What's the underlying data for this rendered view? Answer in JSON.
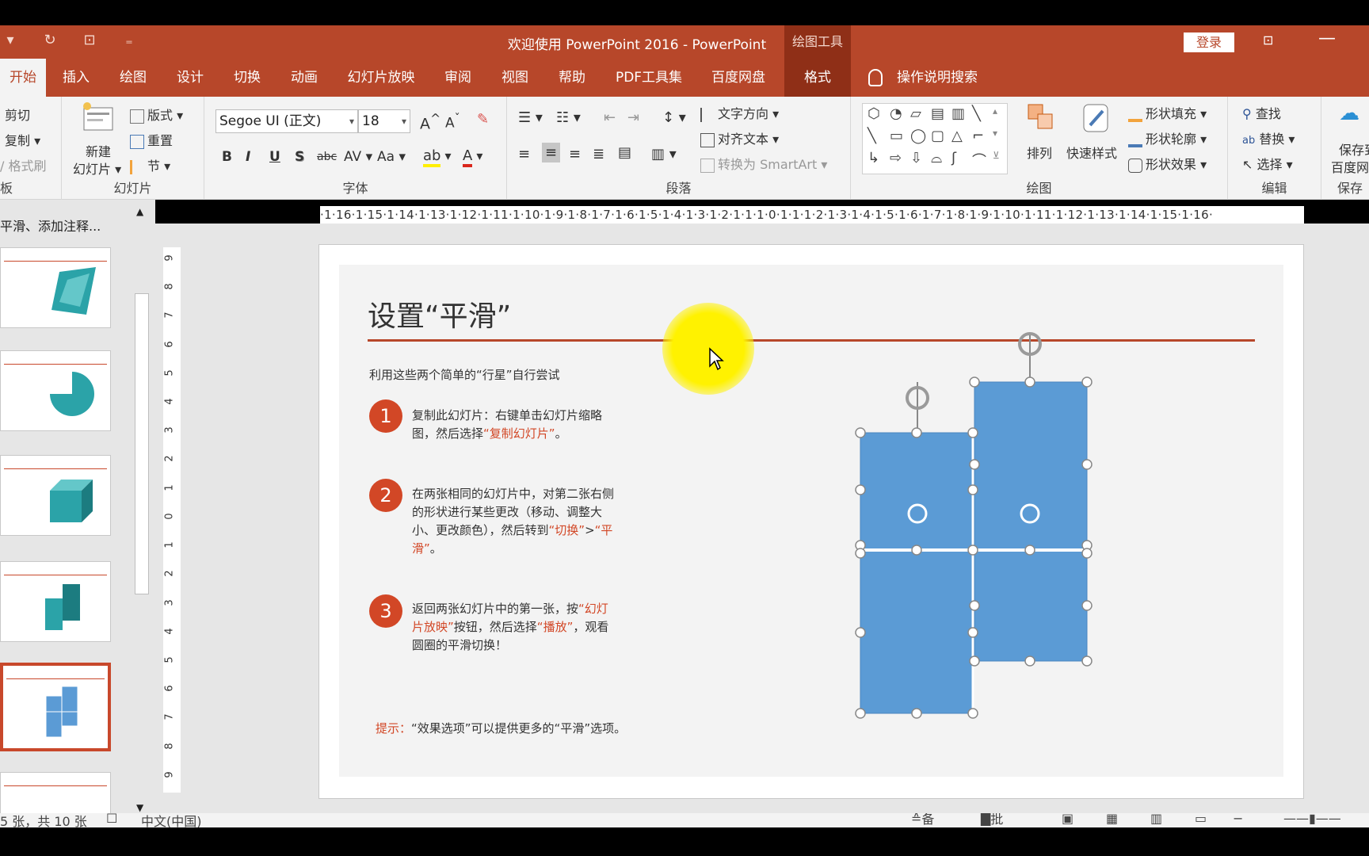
{
  "titlebar": {
    "title": "欢迎使用 PowerPoint 2016  -  PowerPoint",
    "contextual_tab_group": "绘图工具",
    "login": "登录",
    "qat": [
      "▾",
      "↻",
      "⊡",
      "₌"
    ]
  },
  "tabs": [
    "开始",
    "插入",
    "绘图",
    "设计",
    "切换",
    "动画",
    "幻灯片放映",
    "审阅",
    "视图",
    "帮助",
    "PDF工具集",
    "百度网盘",
    "格式"
  ],
  "active_tab": "开始",
  "tellme": "操作说明搜索",
  "ribbon": {
    "clipboard": {
      "cut": "剪切",
      "copy": "复制",
      "format_painter": "格式刷",
      "label": "板"
    },
    "slides": {
      "new_slide_1": "新建",
      "new_slide_2": "幻灯片",
      "layout": "版式",
      "reset": "重置",
      "section": "节",
      "label": "幻灯片"
    },
    "font": {
      "font_name": "Segoe UI (正文)",
      "font_size": "18",
      "label": "字体",
      "buttons": [
        "B",
        "I",
        "U",
        "S",
        "abc",
        "AV",
        "Aa"
      ]
    },
    "paragraph": {
      "text_direction": "文字方向",
      "align_text": "对齐文本",
      "smartart": "转换为 SmartArt",
      "label": "段落"
    },
    "drawing": {
      "arrange": "排列",
      "quick_styles": "快速样式",
      "fill": "形状填充",
      "outline": "形状轮廓",
      "effects": "形状效果",
      "label": "绘图"
    },
    "editing": {
      "find": "查找",
      "replace": "替换",
      "select": "选择",
      "label": "编辑"
    },
    "baidu": {
      "save_1": "保存到",
      "save_2": "百度网",
      "label": "保存"
    }
  },
  "ruler_h": "·1·16·1·15·1·14·1·13·1·12·1·11·1·10·1·9·1·8·1·7·1·6·1·5·1·4·1·3·1·2·1·1·1·0·1·1·1·2·1·3·1·4·1·5·1·6·1·7·1·8·1·9·1·10·1·11·1·12·1·13·1·14·1·15·1·16·",
  "ruler_v": [
    "9",
    "8",
    "7",
    "6",
    "5",
    "4",
    "3",
    "2",
    "1",
    "0",
    "1",
    "2",
    "3",
    "4",
    "5",
    "6",
    "7",
    "8",
    "9"
  ],
  "leftpane": {
    "section_title": "平滑、添加注释..."
  },
  "slide": {
    "title": "设置“平滑”",
    "subtitle": "利用这些两个简单的“行星”自行尝试",
    "steps": [
      {
        "num": "1",
        "a": "复制此幻灯片：右键单击幻灯片缩略图，然后选择",
        "b": "“复制幻灯片”",
        "c": "。"
      },
      {
        "num": "2",
        "a": "在两张相同的幻灯片中，对第二张右侧的形状进行某些更改（移动、调整大小、更改颜色），然后转到",
        "b": "“切换”",
        "c": ">",
        "d": "“平滑”",
        "e": "。"
      },
      {
        "num": "3",
        "a": "返回两张幻灯片中的第一张，按",
        "b": "“幻灯片放映”",
        "c": "按钮，然后选择",
        "d": "“播放”",
        "e": "，观看圆圈的平滑切换！"
      }
    ],
    "tip_label": "提示：",
    "tip_text": "“效果选项”可以提供更多的“平滑”选项。"
  },
  "status": {
    "slide_info": "5 张，共 10 张",
    "language": "中文(中国)",
    "notes": "备注",
    "comments": "批注"
  },
  "colors": {
    "accent": "#b7472a",
    "shape_fill": "#5b9bd5",
    "highlight": "#fff200"
  }
}
